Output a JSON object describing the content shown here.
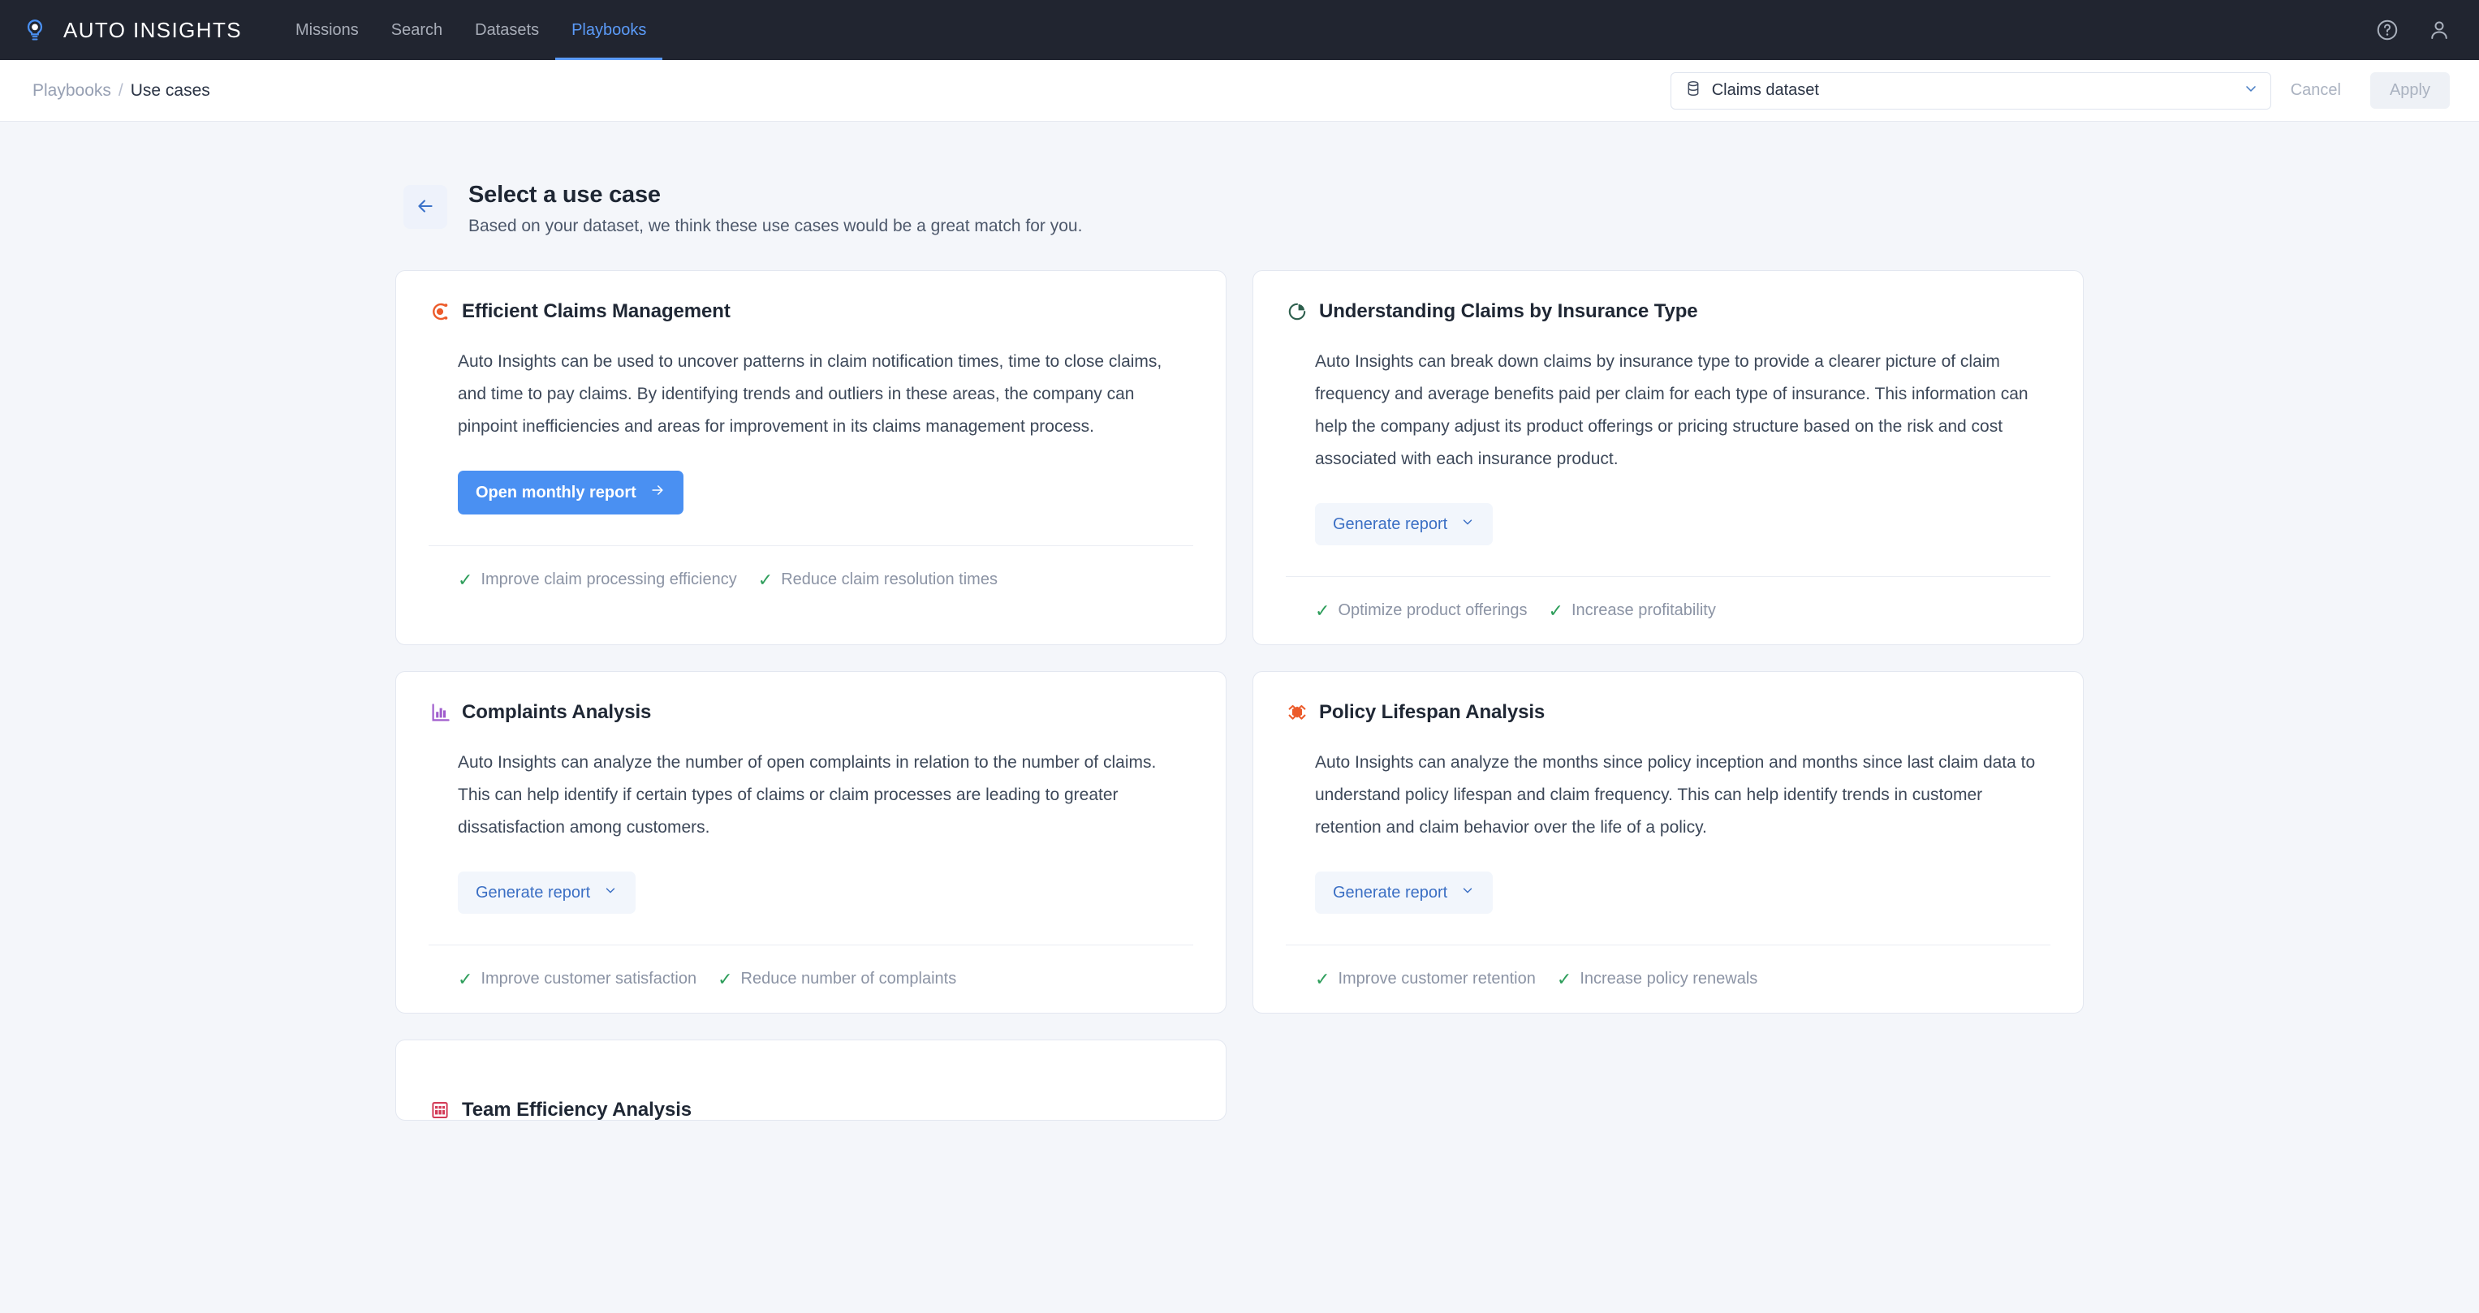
{
  "topnav": {
    "logo_icon": "lightbulb-icon",
    "brand": "AUTO INSIGHTS",
    "links": [
      {
        "label": "Missions",
        "active": false
      },
      {
        "label": "Search",
        "active": false
      },
      {
        "label": "Datasets",
        "active": false
      },
      {
        "label": "Playbooks",
        "active": true
      }
    ],
    "help_icon": "help-circle-icon",
    "account_icon": "user-icon",
    "bg_color": "#212530",
    "accent_color": "#5b9bf8"
  },
  "subheader": {
    "breadcrumb_parent": "Playbooks",
    "breadcrumb_separator": "/",
    "breadcrumb_current": "Use cases",
    "dataset": {
      "icon": "database-icon",
      "value": "Claims dataset",
      "chevron_icon": "chevron-down-icon"
    },
    "cancel_label": "Cancel",
    "apply_label": "Apply"
  },
  "page_head": {
    "back_icon": "arrow-left-icon",
    "title": "Select a use case",
    "subtitle": "Based on your dataset, we think these use cases would be a great match for you."
  },
  "cards": [
    {
      "icon": "target-dial-icon",
      "icon_color": "#ec5b2b",
      "title": "Efficient Claims Management",
      "body": "Auto Insights can be used to uncover patterns in claim notification times, time to close claims, and time to pay claims. By identifying trends and outliers in these areas, the company can pinpoint inefficiencies and areas for improvement in its claims management process.",
      "action": {
        "label": "Open monthly report",
        "style": "primary",
        "icon": "arrow-right-icon"
      },
      "benefits": [
        "Improve claim processing efficiency",
        "Reduce claim resolution times"
      ]
    },
    {
      "icon": "pie-chart-icon",
      "icon_color": "#2d5f4d",
      "title": "Understanding Claims by Insurance Type",
      "body": "Auto Insights can break down claims by insurance type to provide a clearer picture of claim frequency and average benefits paid per claim for each type of insurance. This information can help the company adjust its product offerings or pricing structure based on the risk and cost associated with each insurance product.",
      "action": {
        "label": "Generate report",
        "style": "soft",
        "icon": "chevron-down-icon"
      },
      "benefits": [
        "Optimize product offerings",
        "Increase profitability"
      ]
    },
    {
      "icon": "bar-chart-icon",
      "icon_color": "#a05ccd",
      "title": "Complaints Analysis",
      "body": "Auto Insights can analyze the number of open complaints in relation to the number of claims. This can help identify if certain types of claims or claim processes are leading to greater dissatisfaction among customers.",
      "action": {
        "label": "Generate report",
        "style": "soft",
        "icon": "chevron-down-icon"
      },
      "benefits": [
        "Improve customer satisfaction",
        "Reduce number of complaints"
      ]
    },
    {
      "icon": "hexagon-chevron-icon",
      "icon_color": "#ec5b2b",
      "title": "Policy Lifespan Analysis",
      "body": "Auto Insights can analyze the months since policy inception and months since last claim data to understand policy lifespan and claim frequency. This can help identify trends in customer retention and claim behavior over the life of a policy.",
      "action": {
        "label": "Generate report",
        "style": "soft",
        "icon": "chevron-down-icon"
      },
      "benefits": [
        "Improve customer retention",
        "Increase policy renewals"
      ]
    }
  ],
  "partial_card": {
    "icon": "grid-table-icon",
    "icon_color": "#d33b57",
    "title": "Team Efficiency Analysis"
  }
}
